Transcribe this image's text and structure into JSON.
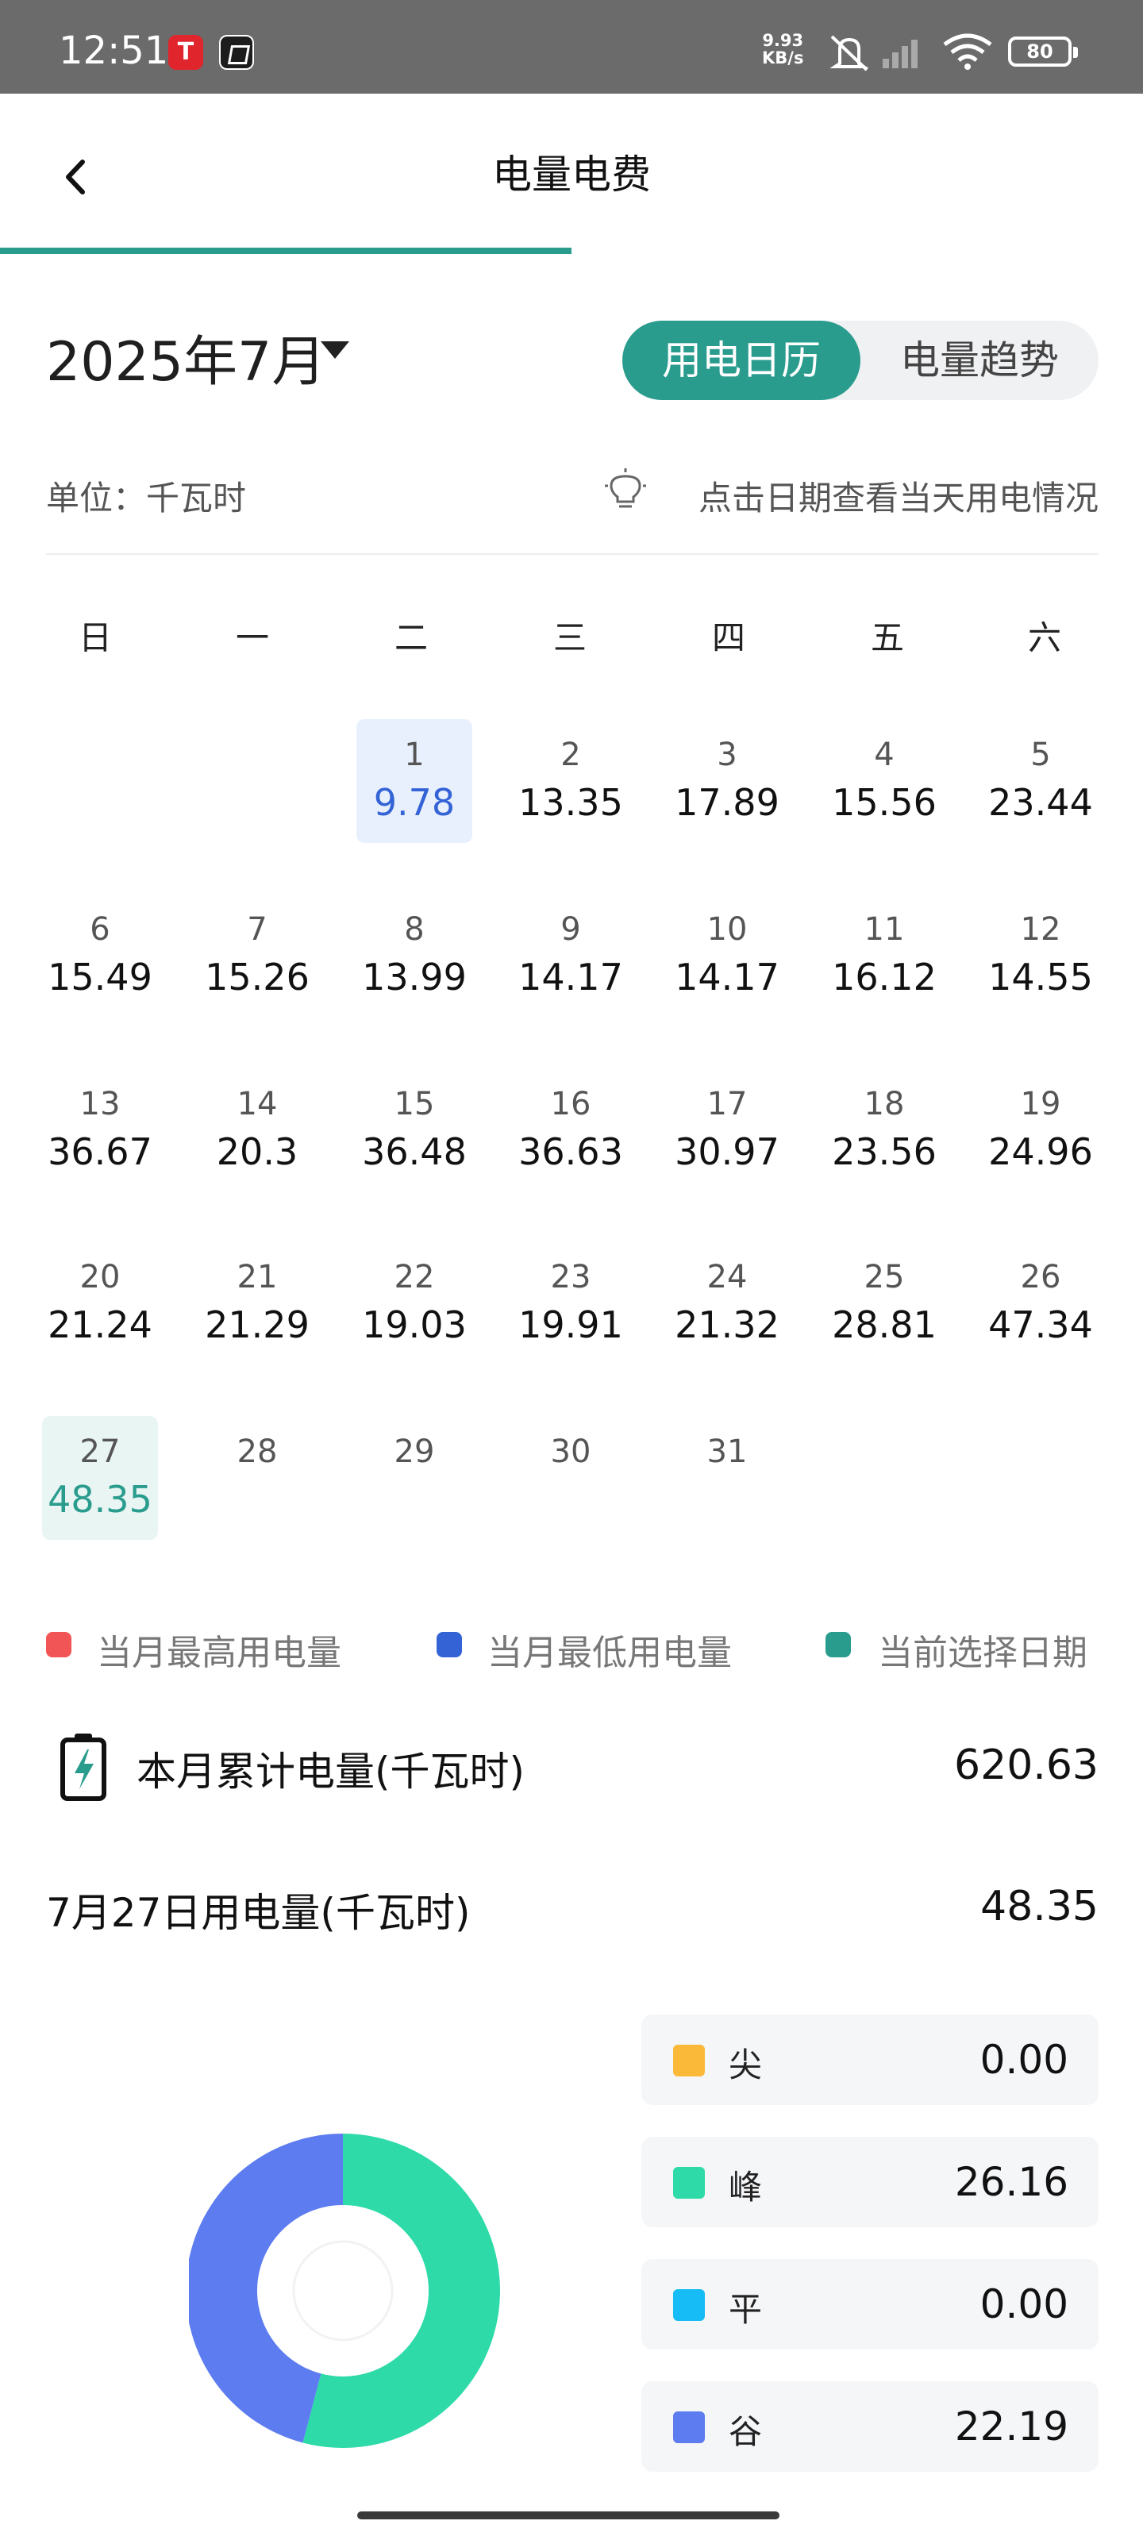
{
  "status_bar": {
    "time": "12:51",
    "net_speed_value": "9.93",
    "net_speed_unit": "KB/s",
    "battery": "80",
    "icons": [
      "tesla-app-icon",
      "notification-app-icon",
      "mute-icon",
      "cellular-signal-icon",
      "wifi-icon",
      "battery-icon"
    ]
  },
  "header": {
    "title": "电量电费",
    "progress_percent": 50
  },
  "controls": {
    "month": "2025年7月",
    "tabs": [
      {
        "label": "用电日历",
        "active": true
      },
      {
        "label": "电量趋势",
        "active": false
      }
    ],
    "unit": "单位：千瓦时",
    "hint": "点击日期查看当天用电情况"
  },
  "calendar": {
    "weekdays": [
      "日",
      "一",
      "二",
      "三",
      "四",
      "五",
      "六"
    ],
    "first_weekday_index": 2,
    "highlight_colors": {
      "lowest": "#3463d6",
      "selected": "#2a9c8d"
    },
    "days": [
      {
        "day": "1",
        "value": "9.78",
        "state": "lowest"
      },
      {
        "day": "2",
        "value": "13.35"
      },
      {
        "day": "3",
        "value": "17.89"
      },
      {
        "day": "4",
        "value": "15.56"
      },
      {
        "day": "5",
        "value": "23.44"
      },
      {
        "day": "6",
        "value": "15.49"
      },
      {
        "day": "7",
        "value": "15.26"
      },
      {
        "day": "8",
        "value": "13.99"
      },
      {
        "day": "9",
        "value": "14.17"
      },
      {
        "day": "10",
        "value": "14.17"
      },
      {
        "day": "11",
        "value": "16.12"
      },
      {
        "day": "12",
        "value": "14.55"
      },
      {
        "day": "13",
        "value": "36.67"
      },
      {
        "day": "14",
        "value": "20.3"
      },
      {
        "day": "15",
        "value": "36.48"
      },
      {
        "day": "16",
        "value": "36.63"
      },
      {
        "day": "17",
        "value": "30.97"
      },
      {
        "day": "18",
        "value": "23.56"
      },
      {
        "day": "19",
        "value": "24.96"
      },
      {
        "day": "20",
        "value": "21.24"
      },
      {
        "day": "21",
        "value": "21.29"
      },
      {
        "day": "22",
        "value": "19.03"
      },
      {
        "day": "23",
        "value": "19.91"
      },
      {
        "day": "24",
        "value": "21.32"
      },
      {
        "day": "25",
        "value": "28.81"
      },
      {
        "day": "26",
        "value": "47.34"
      },
      {
        "day": "27",
        "value": "48.35",
        "state": "selected"
      },
      {
        "day": "28",
        "value": ""
      },
      {
        "day": "29",
        "value": ""
      },
      {
        "day": "30",
        "value": ""
      },
      {
        "day": "31",
        "value": ""
      }
    ]
  },
  "legend": [
    {
      "label": "当月最高用电量",
      "color": "#f25555"
    },
    {
      "label": "当月最低用电量",
      "color": "#3463d6"
    },
    {
      "label": "当前选择日期",
      "color": "#2a9c8d"
    }
  ],
  "summary": {
    "month_total_label": "本月累计电量(千瓦时)",
    "month_total_value": "620.63",
    "day_label": "7月27日用电量(千瓦时)",
    "day_value": "48.35"
  },
  "breakdown": [
    {
      "name": "尖",
      "value": "0.00",
      "color": "#fbb93a"
    },
    {
      "name": "峰",
      "value": "26.16",
      "color": "#2ddaa8"
    },
    {
      "name": "平",
      "value": "0.00",
      "color": "#16bcf5"
    },
    {
      "name": "谷",
      "value": "22.19",
      "color": "#5c7cf0"
    }
  ]
}
